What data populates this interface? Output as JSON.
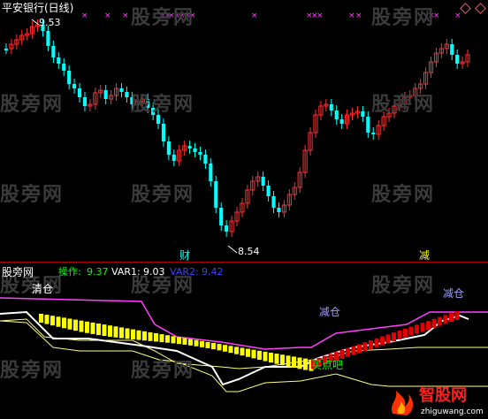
{
  "title": "平安银行(日线)",
  "high_label": "9.53",
  "low_label": "8.54",
  "marker_cai": "财",
  "marker_jian": "减",
  "indicator_name": "股旁网",
  "indicator_values": {
    "caozuo_label": "操作:",
    "caozuo_value": "9.37",
    "var1_label": "VAR1:",
    "var1_value": "9.03",
    "var2_label": "VAR2:",
    "var2_value": "9.42"
  },
  "annotations": {
    "qingcang": "清仓",
    "jiancang_mid": "减仓",
    "jiancang_right": "减仓",
    "maidianba": "买点吧"
  },
  "watermark": "股旁网",
  "logo_text": "智股网",
  "logo_url": "zhiguwang.com",
  "colors": {
    "up": "#ff3030",
    "down": "#00ffff",
    "accent_title": "#ffffff",
    "caozuo": "#00ff00",
    "var2": "#4040ff",
    "magenta": "#ff40ff",
    "yellow": "#ffff00",
    "red_bar": "#e00000"
  }
}
